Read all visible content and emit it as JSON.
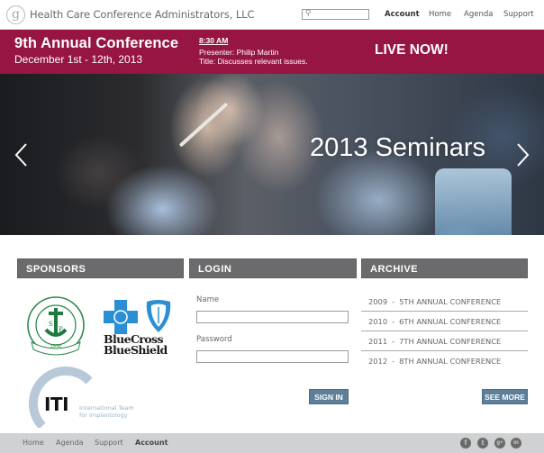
{
  "header": {
    "logo_letter": "g",
    "brand": "Health Care Conference Administrators, LLC",
    "search_placeholder": "",
    "nav": [
      {
        "label": "Account",
        "active": true
      },
      {
        "label": "Home",
        "active": false
      },
      {
        "label": "Agenda",
        "active": false
      },
      {
        "label": "Support",
        "active": false
      }
    ]
  },
  "banner": {
    "title": "9th Annual Conference",
    "dates": "December 1st - 12th, 2013",
    "live_time": "8:30 AM",
    "presenter": "Presenter: Philip Martin",
    "session_title": "Title: Discusses relevant issues.",
    "live_label": "LIVE NOW!",
    "color": "#961542"
  },
  "hero": {
    "caption": "2013 Seminars",
    "prev_icon": "chevron-left-icon",
    "next_icon": "chevron-right-icon"
  },
  "sections": {
    "sponsors": {
      "heading": "SPONSORS",
      "items": [
        {
          "name": "Perpetual Succour Hospital",
          "ring_text": "PERPETUAL SUCCOUR HOSPITAL",
          "year": "1936",
          "ribbon": "YEARS OF LOVING SERVICE",
          "initials_s": "S",
          "initials_p": "P"
        },
        {
          "name": "BlueCross BlueShield",
          "line1": "BlueCross",
          "line2": "BlueShield"
        },
        {
          "name": "ITI",
          "mark": "ITI",
          "sub1": "International Team",
          "sub2": "for Implantology"
        }
      ]
    },
    "login": {
      "heading": "LOGIN",
      "name_label": "Name",
      "name_value": "",
      "password_label": "Password",
      "password_value": "",
      "submit_label": "SIGN IN"
    },
    "archive": {
      "heading": "ARCHIVE",
      "items": [
        {
          "year": "2009",
          "title": "5TH ANNUAL CONFERENCE"
        },
        {
          "year": "2010",
          "title": "6TH ANNUAL CONFERENCE"
        },
        {
          "year": "2011",
          "title": "7TH ANNUAL CONFERENCE"
        },
        {
          "year": "2012",
          "title": "8TH ANNUAL CONFERENCE"
        }
      ],
      "separator": "-",
      "more_label": "SEE MORE"
    }
  },
  "footer": {
    "links": [
      {
        "label": "Home",
        "active": false
      },
      {
        "label": "Agenda",
        "active": false
      },
      {
        "label": "Support",
        "active": false
      },
      {
        "label": "Account",
        "active": true
      }
    ],
    "social": [
      {
        "icon": "facebook-icon",
        "glyph": "f"
      },
      {
        "icon": "twitter-icon",
        "glyph": "t"
      },
      {
        "icon": "google-plus-icon",
        "glyph": "g+"
      },
      {
        "icon": "linkedin-icon",
        "glyph": "in"
      }
    ]
  }
}
